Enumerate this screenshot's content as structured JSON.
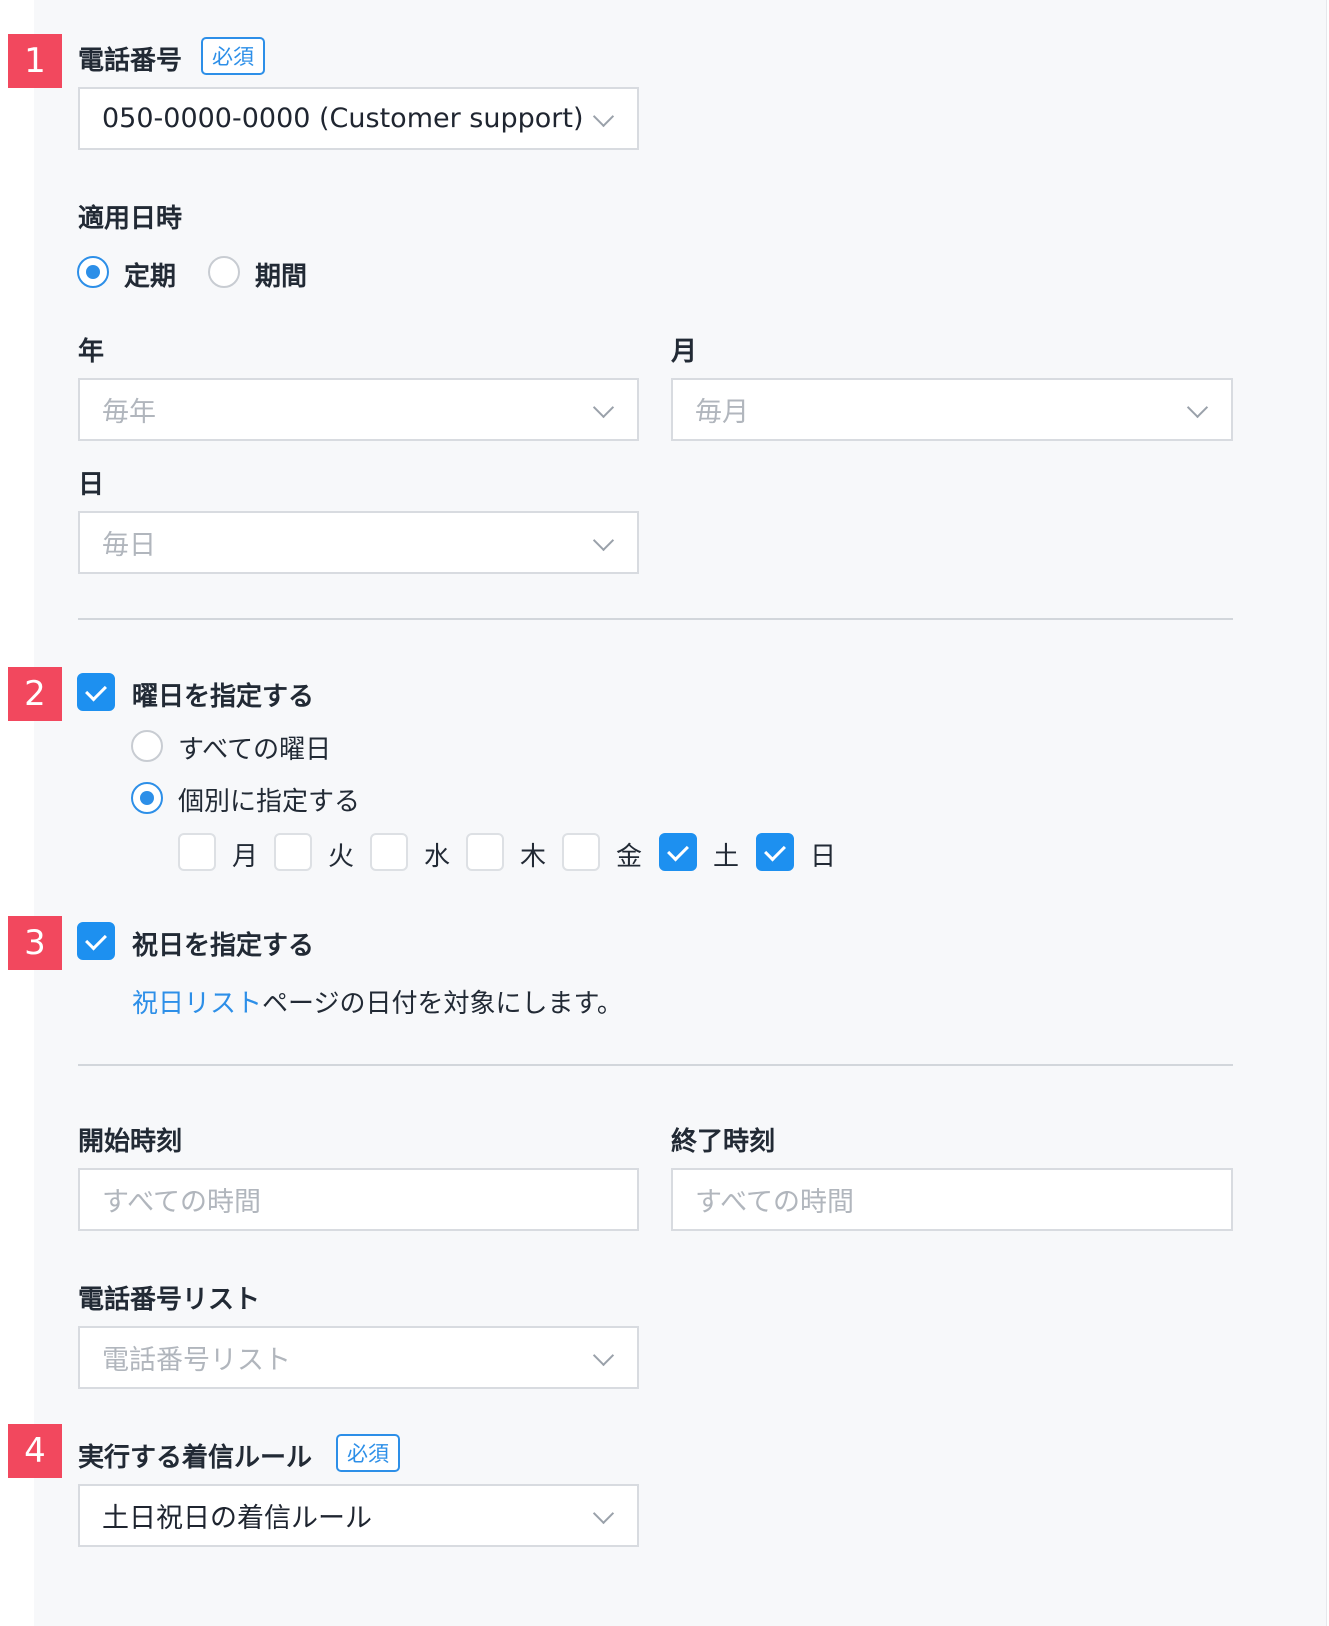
{
  "markers": [
    "1",
    "2",
    "3",
    "4"
  ],
  "required_badge": "必須",
  "phone": {
    "label": "電話番号",
    "value": "050-0000-0000 (Customer support)"
  },
  "apply_datetime": {
    "label": "適用日時",
    "options": [
      {
        "label": "定期",
        "selected": true
      },
      {
        "label": "期間",
        "selected": false
      }
    ]
  },
  "year": {
    "label": "年",
    "placeholder": "毎年"
  },
  "month": {
    "label": "月",
    "placeholder": "毎月"
  },
  "day": {
    "label": "日",
    "placeholder": "毎日"
  },
  "weekday": {
    "label": "曜日を指定する",
    "checked": true,
    "options": [
      {
        "label": "すべての曜日",
        "selected": false
      },
      {
        "label": "個別に指定する",
        "selected": true
      }
    ],
    "days": [
      {
        "label": "月",
        "checked": false
      },
      {
        "label": "火",
        "checked": false
      },
      {
        "label": "水",
        "checked": false
      },
      {
        "label": "木",
        "checked": false
      },
      {
        "label": "金",
        "checked": false
      },
      {
        "label": "土",
        "checked": true
      },
      {
        "label": "日",
        "checked": true
      }
    ]
  },
  "holiday": {
    "label": "祝日を指定する",
    "checked": true,
    "link_text": "祝日リスト",
    "description": "ページの日付を対象にします。"
  },
  "start_time": {
    "label": "開始時刻",
    "placeholder": "すべての時間"
  },
  "end_time": {
    "label": "終了時刻",
    "placeholder": "すべての時間"
  },
  "phone_list": {
    "label": "電話番号リスト",
    "placeholder": "電話番号リスト"
  },
  "rule": {
    "label": "実行する着信ルール",
    "value": "土日祝日の着信ルール"
  },
  "colors": {
    "accent": "#1d90f0",
    "marker": "#f2485e",
    "panel_bg": "#f7f8fa"
  }
}
